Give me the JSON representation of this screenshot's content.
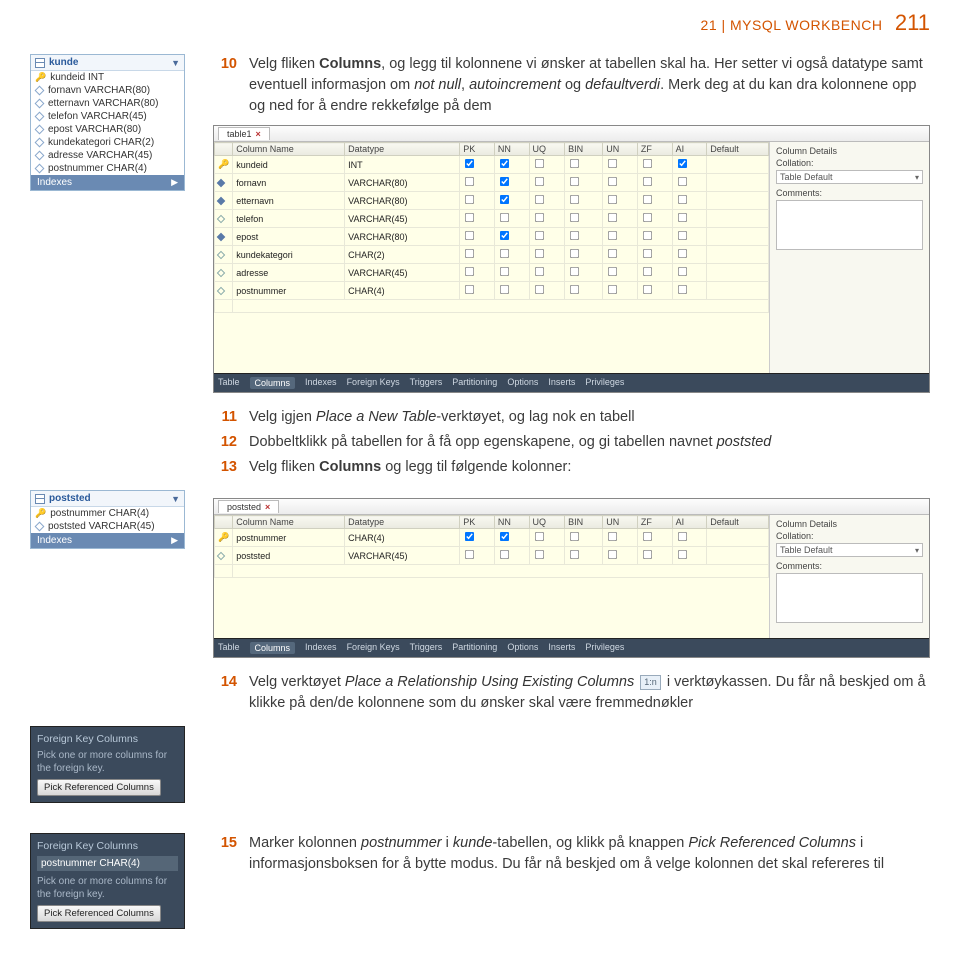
{
  "header": {
    "section": "21 | MYSQL WORKBENCH",
    "page": "211"
  },
  "sidepanels": {
    "kunde": {
      "title": "kunde",
      "columns": [
        {
          "pk": true,
          "name": "kundeid INT"
        },
        {
          "pk": false,
          "name": "fornavn VARCHAR(80)"
        },
        {
          "pk": false,
          "name": "etternavn VARCHAR(80)"
        },
        {
          "pk": false,
          "name": "telefon VARCHAR(45)"
        },
        {
          "pk": false,
          "name": "epost VARCHAR(80)"
        },
        {
          "pk": false,
          "name": "kundekategori CHAR(2)"
        },
        {
          "pk": false,
          "name": "adresse VARCHAR(45)"
        },
        {
          "pk": false,
          "name": "postnummer CHAR(4)"
        }
      ],
      "indexes": "Indexes"
    },
    "poststed": {
      "title": "poststed",
      "columns": [
        {
          "pk": true,
          "name": "postnummer CHAR(4)"
        },
        {
          "pk": false,
          "name": "poststed VARCHAR(45)"
        }
      ],
      "indexes": "Indexes"
    },
    "fk1": {
      "title": "Foreign Key Columns",
      "hint": "Pick one or more columns for the foreign key.",
      "btn": "Pick Referenced Columns"
    },
    "fk2": {
      "title": "Foreign Key Columns",
      "selected": "postnummer CHAR(4)",
      "hint": "Pick one or more columns for the foreign key.",
      "btn": "Pick Referenced Columns"
    }
  },
  "steps": {
    "s10": {
      "num": "10",
      "text_lead": "Velg fliken ",
      "text_bold1": "Columns",
      "text_mid": ", og legg til kolonnene vi ønsker at tabellen skal ha. Her setter vi også datatype samt eventuell informasjon om ",
      "text_em1": "not null",
      "text_mid2": ", ",
      "text_em2": "autoincrement",
      "text_mid3": " og ",
      "text_em3": "defaultverdi",
      "text_mid4": ". Merk deg at du kan dra kolonnene opp og ned for å endre rekkefølge på dem"
    },
    "s11": {
      "num": "11",
      "text_lead": "Velg igjen ",
      "text_em1": "Place a New Table",
      "text_rest": "-verktøyet, og lag nok en tabell"
    },
    "s12": {
      "num": "12",
      "text_lead": "Dobbeltklikk på tabellen for å få opp egenskapene, og gi tabellen navnet ",
      "text_em1": "poststed"
    },
    "s13": {
      "num": "13",
      "text_lead": "Velg fliken ",
      "text_bold1": "Columns",
      "text_rest": " og legg til følgende kolonner:"
    },
    "s14": {
      "num": "14",
      "text_lead": "Velg verktøyet ",
      "text_em1": "Place a Relationship Using Existing Columns",
      "relicon": "1:n",
      "text_mid": " i verktøykassen. Du får nå beskjed om å klikke på den/de kolonnene som du ønsker skal være fremmednøkler"
    },
    "s15": {
      "num": "15",
      "text_lead": "Marker kolonnen ",
      "text_em1": "postnummer",
      "text_mid": " i ",
      "text_em2": "kunde",
      "text_mid2": "-tabellen, og klikk på knappen ",
      "text_em3": "Pick Referenced Columns",
      "text_mid3": " i informasjonsboksen for å bytte modus. Du får nå beskjed om å velge kolonnen det skal refereres til"
    }
  },
  "wb_common": {
    "headers": [
      "Column Name",
      "Datatype",
      "PK",
      "NN",
      "UQ",
      "BIN",
      "UN",
      "ZF",
      "AI",
      "Default"
    ],
    "side_heading": "Column Details",
    "collation_label": "Collation:",
    "collation_value": "Table Default",
    "comments_label": "Comments:",
    "bottom_tabs": [
      "Table",
      "Columns",
      "Indexes",
      "Foreign Keys",
      "Triggers",
      "Partitioning",
      "Options",
      "Inserts",
      "Privileges"
    ]
  },
  "wb1": {
    "tab": "table1",
    "rows": [
      {
        "key": true,
        "dia": "filled",
        "name": "kundeid",
        "type": "INT",
        "pk": true,
        "nn": true,
        "uq": false,
        "bin": false,
        "un": false,
        "zf": false,
        "ai": true,
        "def": ""
      },
      {
        "key": false,
        "dia": "filled",
        "name": "fornavn",
        "type": "VARCHAR(80)",
        "pk": false,
        "nn": true,
        "uq": false,
        "bin": false,
        "un": false,
        "zf": false,
        "ai": false,
        "def": ""
      },
      {
        "key": false,
        "dia": "filled",
        "name": "etternavn",
        "type": "VARCHAR(80)",
        "pk": false,
        "nn": true,
        "uq": false,
        "bin": false,
        "un": false,
        "zf": false,
        "ai": false,
        "def": ""
      },
      {
        "key": false,
        "dia": "open",
        "name": "telefon",
        "type": "VARCHAR(45)",
        "pk": false,
        "nn": false,
        "uq": false,
        "bin": false,
        "un": false,
        "zf": false,
        "ai": false,
        "def": ""
      },
      {
        "key": false,
        "dia": "filled",
        "name": "epost",
        "type": "VARCHAR(80)",
        "pk": false,
        "nn": true,
        "uq": false,
        "bin": false,
        "un": false,
        "zf": false,
        "ai": false,
        "def": ""
      },
      {
        "key": false,
        "dia": "open",
        "name": "kundekategori",
        "type": "CHAR(2)",
        "pk": false,
        "nn": false,
        "uq": false,
        "bin": false,
        "un": false,
        "zf": false,
        "ai": false,
        "def": ""
      },
      {
        "key": false,
        "dia": "open",
        "name": "adresse",
        "type": "VARCHAR(45)",
        "pk": false,
        "nn": false,
        "uq": false,
        "bin": false,
        "un": false,
        "zf": false,
        "ai": false,
        "def": ""
      },
      {
        "key": false,
        "dia": "open",
        "name": "postnummer",
        "type": "CHAR(4)",
        "pk": false,
        "nn": false,
        "uq": false,
        "bin": false,
        "un": false,
        "zf": false,
        "ai": false,
        "def": ""
      }
    ]
  },
  "wb2": {
    "tab": "poststed",
    "rows": [
      {
        "key": true,
        "dia": "filled",
        "name": "postnummer",
        "type": "CHAR(4)",
        "pk": true,
        "nn": true,
        "uq": false,
        "bin": false,
        "un": false,
        "zf": false,
        "ai": false,
        "def": ""
      },
      {
        "key": false,
        "dia": "open",
        "name": "poststed",
        "type": "VARCHAR(45)",
        "pk": false,
        "nn": false,
        "uq": false,
        "bin": false,
        "un": false,
        "zf": false,
        "ai": false,
        "def": ""
      }
    ]
  }
}
